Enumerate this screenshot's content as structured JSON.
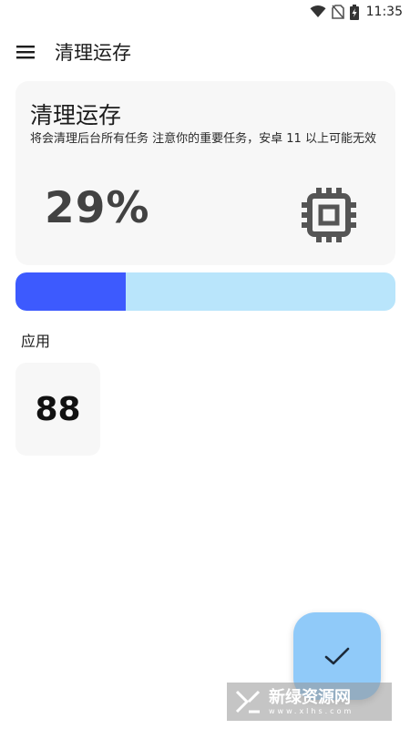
{
  "status_bar": {
    "time": "11:35",
    "icons": [
      "wifi-icon",
      "no-sim-icon",
      "battery-charging-icon"
    ]
  },
  "app_bar": {
    "menu_icon": "hamburger-menu-icon",
    "title": "清理运存"
  },
  "info_card": {
    "title": "清理运存",
    "description": "将会清理后台所有任务 注意你的重要任务，安卓 11 以上可能无效",
    "percent_text": "29%",
    "icon": "memory-chip-icon"
  },
  "progress": {
    "value": 0.29,
    "fill_color": "#3d5afe",
    "track_color": "#b9e5fb"
  },
  "apps_section": {
    "label": "应用",
    "count": "88"
  },
  "fab": {
    "icon": "check-icon",
    "color": "#90caf9"
  },
  "watermark": {
    "brand": "新绿资源网",
    "domain": "www.xlhs.com"
  }
}
